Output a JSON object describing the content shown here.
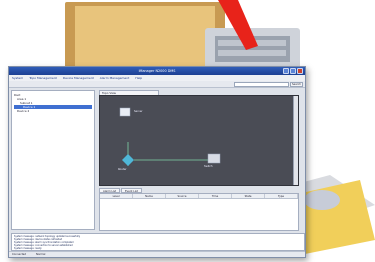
{
  "window": {
    "title": "iManager N2000 DMS",
    "status_left": "Connected",
    "status_right": "Normal"
  },
  "menu": [
    "System",
    "Topo Management",
    "Device Management",
    "Alarm Management",
    "Help"
  ],
  "toolbar": {
    "search_placeholder": "",
    "search_button": "Search"
  },
  "tree": {
    "items": [
      {
        "label": "Root",
        "level": 0,
        "selected": false
      },
      {
        "label": "Area 1",
        "level": 1,
        "selected": false
      },
      {
        "label": "Subnet 1",
        "level": 2,
        "selected": false
      },
      {
        "label": "Device 1",
        "level": 3,
        "selected": true
      },
      {
        "label": "Device 2",
        "level": 1,
        "selected": false
      }
    ]
  },
  "topology": {
    "tab_label": "Topo View",
    "nodes": [
      {
        "label": "Server"
      },
      {
        "label": "Router"
      },
      {
        "label": "Switch"
      }
    ]
  },
  "table": {
    "tabs": [
      "Alarm List",
      "Event List"
    ],
    "columns": [
      "Level",
      "Name",
      "Source",
      "Time",
      "State",
      "Type"
    ]
  },
  "log": {
    "lines": [
      "System message: network topology updated successfully",
      "System message: device status refreshed",
      "System message: alarm synchronization completed",
      "System message: connection to server established",
      "System message: ready"
    ]
  },
  "colors": {
    "titlebar": "#2f5db8",
    "topology_bg": "#4a4c55",
    "selection": "#3f6fd1",
    "link": "#7fd4a8"
  }
}
